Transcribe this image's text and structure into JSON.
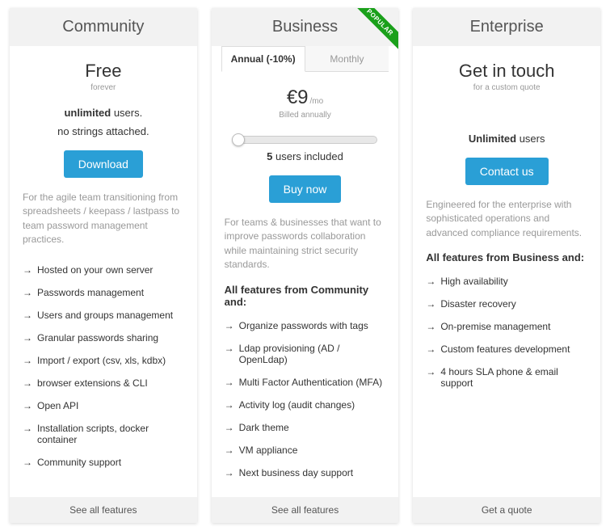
{
  "plans": {
    "community": {
      "title": "Community",
      "price": "Free",
      "price_sub": "forever",
      "users_html_prefix": "unlimited",
      "users_suffix": " users.",
      "tagline": "no strings attached.",
      "button": "Download",
      "description": "For the agile team transitioning from spreadsheets / keepass / lastpass to team password management practices.",
      "features": [
        "Hosted on your own server",
        "Passwords management",
        "Users and groups management",
        "Granular passwords sharing",
        "Import / export (csv, xls, kdbx)",
        "browser extensions & CLI",
        "Open API",
        "Installation scripts, docker container",
        "Community support"
      ],
      "footer": "See all features"
    },
    "business": {
      "title": "Business",
      "ribbon": "POPULAR",
      "tabs": {
        "annual": "Annual (-10%)",
        "monthly": "Monthly"
      },
      "price": "€9",
      "price_unit": "/mo",
      "price_sub": "Billed annually",
      "users_count": "5",
      "users_suffix": " users included",
      "button": "Buy now",
      "description": "For teams & businesses that want to improve passwords collaboration while maintaining strict security standards.",
      "features_header": "All features from Community and:",
      "features": [
        "Organize passwords with tags",
        "Ldap provisioning (AD / OpenLdap)",
        "Multi Factor Authentication (MFA)",
        "Activity log (audit changes)",
        "Dark theme",
        "VM appliance",
        "Next business day support"
      ],
      "footer": "See all features"
    },
    "enterprise": {
      "title": "Enterprise",
      "price": "Get in touch",
      "price_sub": "for a custom quote",
      "users_prefix": "Unlimited",
      "users_suffix": " users",
      "button": "Contact us",
      "description": "Engineered for the enterprise with sophisticated operations and advanced compliance requirements.",
      "features_header": "All features from Business and:",
      "features": [
        "High availability",
        "Disaster recovery",
        "On-premise management",
        "Custom features development",
        "4 hours SLA phone & email support"
      ],
      "footer": "Get a quote"
    }
  }
}
